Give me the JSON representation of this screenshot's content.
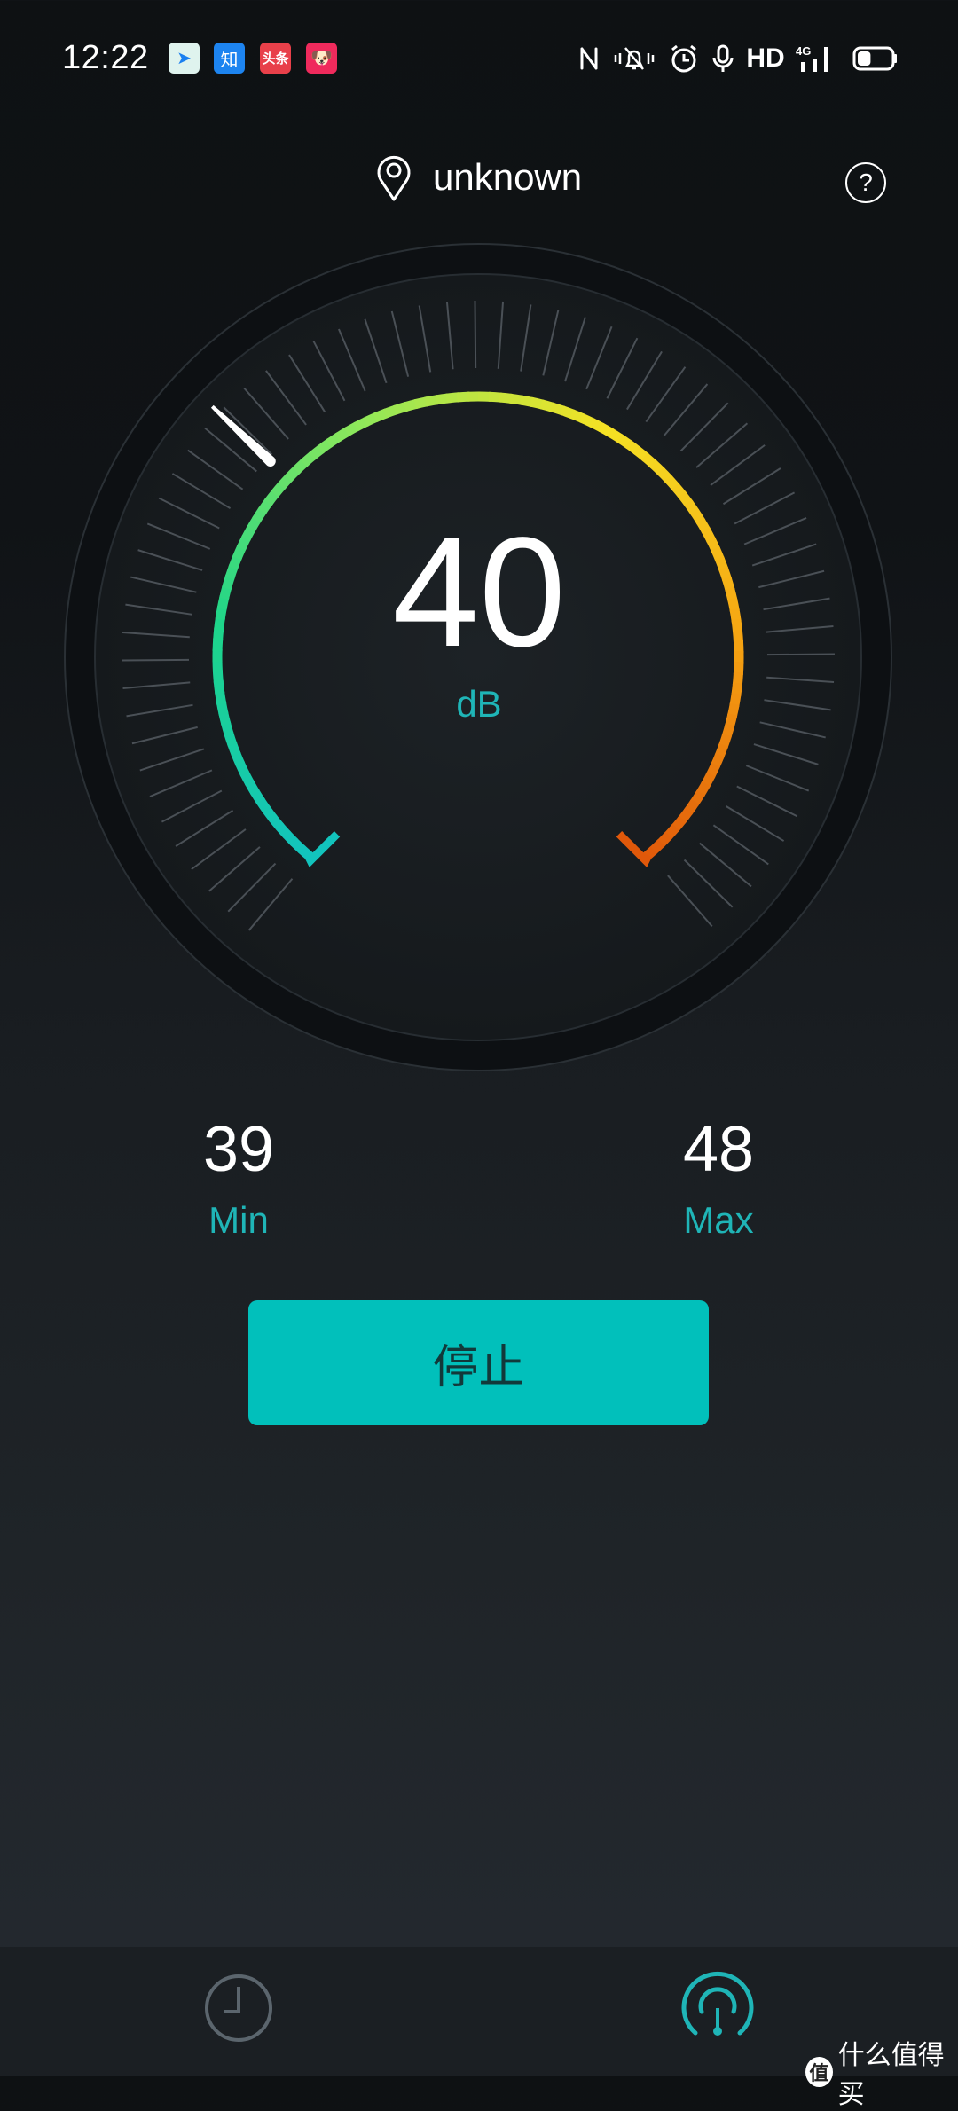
{
  "status_bar": {
    "time": "12:22",
    "notifications": [
      {
        "name": "feizhu-travel-app-icon",
        "glyph": "➤",
        "bg": "#dff3ee",
        "fg": "#1a7ff0"
      },
      {
        "name": "zhihu-app-icon",
        "glyph": "知",
        "bg": "#1d84f0",
        "fg": "#ffffff"
      },
      {
        "name": "toutiao-app-icon",
        "glyph": "头条",
        "bg": "#e8404a",
        "fg": "#ffffff"
      },
      {
        "name": "promo-app-icon",
        "glyph": "🐶",
        "bg": "#ef2a5c",
        "fg": "#ffffff"
      }
    ],
    "network_label": "HD",
    "signal_label": "4G",
    "battery_level": 0.4
  },
  "header": {
    "location": "unknown",
    "help_label": "?"
  },
  "meter": {
    "value": "40",
    "unit": "dB",
    "scale_min": 0,
    "scale_max": 120,
    "arc_colors": [
      "#12c4bd",
      "#1ed58a",
      "#8fe85a",
      "#f5e224",
      "#f6a512",
      "#e0580a"
    ]
  },
  "stats": {
    "min_value": "39",
    "min_label": "Min",
    "max_value": "48",
    "max_label": "Max"
  },
  "actions": {
    "stop_label": "停止"
  },
  "bottom_nav": {
    "items": [
      {
        "name": "history",
        "active": false
      },
      {
        "name": "meter",
        "active": true
      }
    ],
    "active_color": "#1fb5b7",
    "inactive_color": "#5b656d"
  },
  "watermark": {
    "logo": "值",
    "text": "什么值得买"
  }
}
